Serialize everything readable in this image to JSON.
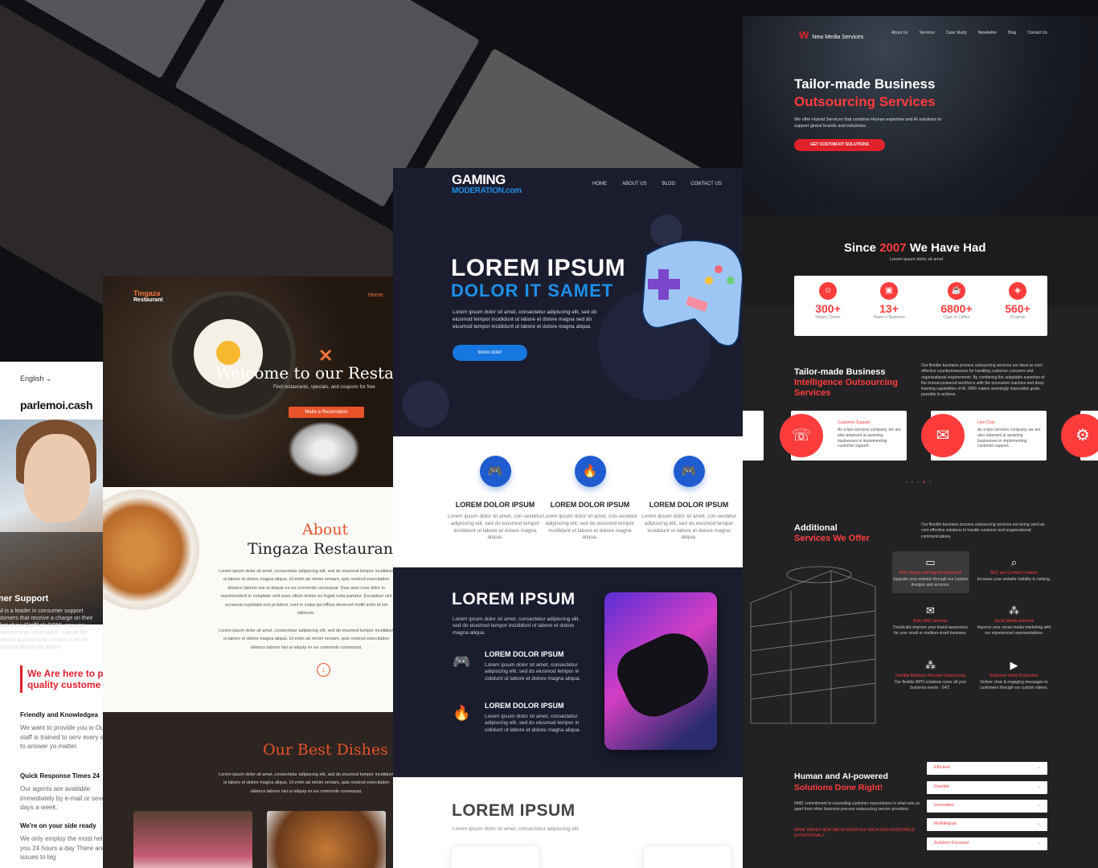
{
  "parlemoi": {
    "language": "English",
    "logo": "parlemoi.cash",
    "support_title": "ner Support",
    "support_desc": "M is a leader in consumer support stomers that receive a charge on their that show 'Staff1ab.COM', can use membership information, submit bill related questions or contact a ve for support directly by phone.",
    "heading": "We Are here to p quality custome",
    "items": [
      {
        "title": "Friendly and Knowledgea",
        "text": "We want to provide you w Our staff is trained to serv every effort to answer yo matter."
      },
      {
        "title": "Quick Response Times 24",
        "text": "Our agents are available immediately by e-mail or seven days a week."
      },
      {
        "title": "We're on your side ready",
        "text": "We only employ the most help you 24 hours a day There are no issues to big"
      }
    ]
  },
  "tingaza": {
    "logo_line1": "Tingaza",
    "logo_line2": "Restaurant",
    "menu": "Home",
    "welcome": "Welcome to our Resta",
    "find": "Find restaurants, specials, and coupons for free",
    "reserve": "Make a Reservation",
    "about": "About",
    "name": "Tingaza Restauran",
    "para1": "Lorem ipsum dolor sit amet, consectetur adipiscing elit, sed do eiusmod tempor incididunt ut labore et dolore magna aliqua. Ut enim ad minim veniam, quis nostrud exercitation ullamco laboris nisi ut aliquip ex ea commodo consequat. Duis aute irure dolor in reprehenderit in voluptate velit esse cillum dolore eu fugiat nulla pariatur. Excepteur sint occaecat cupidatat non proident, sunt in culpa qui officia deserunt mollit anim id est laborum.",
    "para2": "Lorem ipsum dolor sit amet, consectetur adipiscing elit, sed do eiusmod tempor incididunt ut labore et dolore magna aliqua. Ut enim ad minim veniam, quis nostrud exercitation ullamco laboris nisi ut aliquip ex ea commodo consequat.",
    "dishes": "Our Best Dishes",
    "dishes_para": "Lorem ipsum dolor sit amet, consectetur adipiscing elit, sed do eiusmod tempor incididunt ut labore et dolore magna aliqua. Ut enim ad minim veniam, quis nostrud exercitation ullamco laboris nisi ut aliquip ex ea commodo consequat."
  },
  "gaming": {
    "logo_top": "GAMING",
    "logo_bottom": "MODERATION.com",
    "nav": [
      "HOME",
      "ABOUT US",
      "BLOG",
      "CONTACT US"
    ],
    "hero_h1": "LOREM IPSUM",
    "hero_h2": "DOLOR IT SAMET",
    "hero_p": "Lorem ipsum dolor sit amet, consectetur adipiscing elit, sed do eiusmod tempor incididunt ut labore et dolore magna sed do eiusmod tempor incididunt ut labore et dolore magna aliqua.",
    "hero_btn": "lorem dolor",
    "features": [
      {
        "title": "LOREM DOLOR IPSUM",
        "text": "Lorem ipsum dolor sit amet, con-sectetur adipiscing elit, sed do eiusmod tempor incididunt ut labore et dolore magna aliqua."
      },
      {
        "title": "LOREM DOLOR IPSUM",
        "text": "Lorem ipsum dolor sit amet, con-sectetur adipiscing elit, sed do eiusmod tempor incididunt ut labore et dolore magna aliqua."
      },
      {
        "title": "LOREM DOLOR IPSUM",
        "text": "Lorem ipsum dolor sit amet, con-sectetur adipiscing elit, sed do eiusmod tempor incididunt ut labore et dolore magna aliqua."
      }
    ],
    "sec2_h": "LOREM IPSUM",
    "sec2_p": "Lorem ipsum dolor sit amet, consectetur adipiscing elit, sed do eiusmod tempor incididunt ut labore et dolore magna aliqua.",
    "list": [
      {
        "title": "LOREM DOLOR IPSUM",
        "text": "Lorem ipsum dolor sit amet, consectetur adipiscing elit, sed do eiusmod tempor in cididunt ut labore et dolore magna aliqua."
      },
      {
        "title": "LOREM DOLOR IPSUM",
        "text": "Lorem ipsum dolor sit amet, consectetur adipiscing elit, sed do eiusmod tempor in cididunt ut labore et dolore magna aliqua."
      }
    ],
    "sec3_h": "LOREM IPSUM",
    "sec3_p": "Lorem ipsum dolor sit amet, consectetur adipiscing elit."
  },
  "nms": {
    "logo": "New Media Services",
    "nav": [
      "About Us",
      "Services",
      "Case Study",
      "Newsletter",
      "Blog",
      "Contact Us"
    ],
    "hero_h1": "Tailor-made Business",
    "hero_h1b": "Outsourcing Services",
    "hero_p": "We offer Hybrid Services that combine Human expertise and AI solutions to support global brands and industries.",
    "hero_btn": "GET CUSTOM-FIT SOLUTIONS",
    "since_a": "Since ",
    "since_year": "2007",
    "since_b": " We Have Had",
    "since_sub": "Lorem ipsum dolor sit amet",
    "stats": [
      {
        "num": "300+",
        "label": "Happy Clients"
      },
      {
        "num": "13+",
        "label": "Years in Business"
      },
      {
        "num": "6800+",
        "label": "Cups of Coffee"
      },
      {
        "num": "560+",
        "label": "Projects"
      }
    ],
    "bi_title": "Tailor-made Business",
    "bi_title_b": "Intelligence Outsourcing Services",
    "bi_p": "Our flexible business process outsourcing services are ideal as cost-effective countermeasures for handling customer concerns and organizational requirements. By combining the adaptable expertise of the human-powered workforce with the innovative machine and deep learning capabilities of AI, NMS makes seemingly impossible goals possible to achieve.",
    "svc": [
      {
        "title": "Customer Support",
        "text": "As a bpo services company, we are also adamant at assisting businesses in implementing customer support."
      },
      {
        "title": "Live Chat",
        "text": "As a bpo services company, we are also adamant at assisting businesses in implementing customer support."
      }
    ],
    "add_title": "Additional",
    "add_title_b": "Services We Offer",
    "add_p": "Our flexible business process outsourcing services are being used as cost-effective solutions to handle customer and organizational communications.",
    "grid": [
      {
        "title": "Web Design and App Development",
        "text": "Upgrade your website through our custom designs and services."
      },
      {
        "title": "SEO and Content Creation",
        "text": "Increase your website visibility & ranking."
      },
      {
        "title": "Bulk SMS Services",
        "text": "Drastically improve your brand awareness for your small or medium-sized business."
      },
      {
        "title": "Social Media Services",
        "text": "Improve your social media marketing with our experienced representatives."
      },
      {
        "title": "Flexible Business Process Outsourcing",
        "text": "Our flexible BPO solutions cover all your business needs - 24/7."
      },
      {
        "title": "Explainer Video Production",
        "text": "Deliver clear & engaging messages to customers through our custom videos."
      }
    ],
    "ai_title": "Human and AI-powered",
    "ai_title_b": "Solutions Done Right!",
    "ai_p": "NMS' commitment to exceeding customer expectations is what sets us apart from other business process outsourcing service providers.",
    "ai_link": "WHAT MAKES NEW MEDIA SERVICES' BACK-END ASSISTANCE EXCEPTIONAL?",
    "accordion": [
      "Efficient",
      "Flexible",
      "Innovative",
      "Multilingual",
      "Solution-Focused"
    ]
  }
}
